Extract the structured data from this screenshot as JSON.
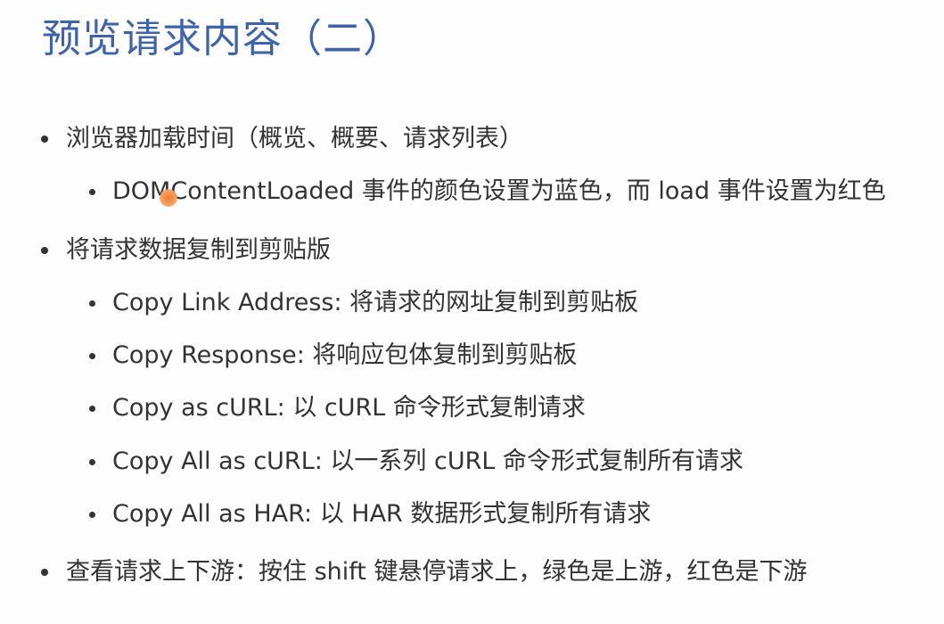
{
  "slide": {
    "title": "预览请求内容（二）",
    "bullets": [
      {
        "text": "浏览器加载时间（概览、概要、请求列表）",
        "children": [
          "DOMContentLoaded 事件的颜色设置为蓝色，而 load 事件设置为红色"
        ]
      },
      {
        "text": "将请求数据复制到剪贴版",
        "children": [
          "Copy Link Address: 将请求的网址复制到剪贴板",
          "Copy Response: 将响应包体复制到剪贴板",
          "Copy as cURL: 以 cURL 命令形式复制请求",
          "Copy All as cURL: 以一系列 cURL 命令形式复制所有请求",
          "Copy All as HAR: 以 HAR 数据形式复制所有请求"
        ]
      },
      {
        "text": "查看请求上下游：按住 shift 键悬停请求上，绿色是上游，红色是下游",
        "children": []
      }
    ]
  },
  "colors": {
    "title": "#3f63a8",
    "text": "#333333",
    "cursor": "#f08030"
  }
}
